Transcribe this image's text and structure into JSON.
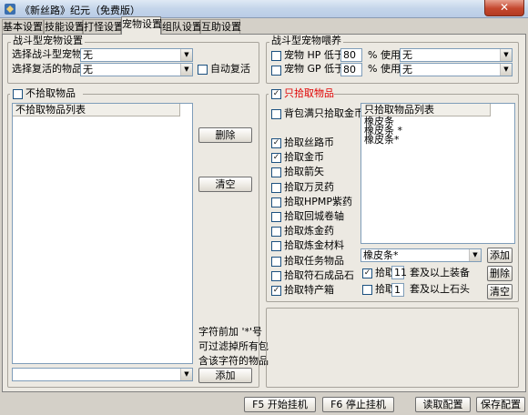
{
  "window": {
    "title": "《新丝路》纪元（免费版）",
    "close_label": "✕"
  },
  "tabs": [
    "基本设置",
    "技能设置",
    "打怪设置",
    "宠物设置",
    "组队设置",
    "互助设置"
  ],
  "pet_settings": {
    "title": "战斗型宠物设置",
    "battle_pet_label": "选择战斗型宠物:",
    "battle_pet_value": "无",
    "revive_item_label": "选择复活的物品:",
    "revive_item_value": "无",
    "auto_revive_label": "自动复活"
  },
  "pet_feeding": {
    "title": "战斗型宠物喂养",
    "hp_label": "宠物 HP 低于:",
    "hp_value": "80",
    "mp_label": "宠物 GP 低于:",
    "mp_value": "80",
    "use_label": "% 使用",
    "hp_item": "无",
    "mp_item": "无"
  },
  "no_pickup": {
    "title": "不拾取物品",
    "list_header": "不拾取物品列表",
    "delete_label": "删除",
    "clear_label": "清空",
    "hint": [
      "字符前加 '*'号",
      "可过滤掉所有包",
      "含该字符的物品"
    ],
    "add_label": "添加",
    "combo_value": ""
  },
  "pickup": {
    "title": "只拾取物品",
    "full_bag_label": "背包满只拾取金币",
    "options": [
      {
        "label": "拾取丝路币",
        "checked": true
      },
      {
        "label": "拾取金币",
        "checked": true
      },
      {
        "label": "拾取箭矢",
        "checked": false
      },
      {
        "label": "拾取万灵药",
        "checked": false
      },
      {
        "label": "拾取HPMP紫药",
        "checked": false
      },
      {
        "label": "拾取回城卷轴",
        "checked": false
      },
      {
        "label": "拾取炼金药",
        "checked": false
      },
      {
        "label": "拾取炼金材料",
        "checked": false
      },
      {
        "label": "拾取任务物品",
        "checked": false
      },
      {
        "label": "拾取符石成品石",
        "checked": false
      },
      {
        "label": "拾取特产箱",
        "checked": true
      }
    ],
    "list_header": "只拾取物品列表",
    "list_items": [
      "橡皮条",
      "橡皮条 *",
      "橡皮条*"
    ],
    "combo_value": "橡皮条*",
    "add_label": "添加",
    "delete_label": "删除",
    "clear_label": "清空",
    "equip_label": "拾取",
    "equip_value": "11",
    "equip_suffix": "套及以上装备",
    "stone_label": "拾取",
    "stone_value": "1",
    "stone_suffix": "套及以上石头"
  },
  "footer": {
    "start_label": "F5 开始挂机",
    "stop_label": "F6 停止挂机",
    "read_label": "读取配置",
    "save_label": "保存配置"
  }
}
